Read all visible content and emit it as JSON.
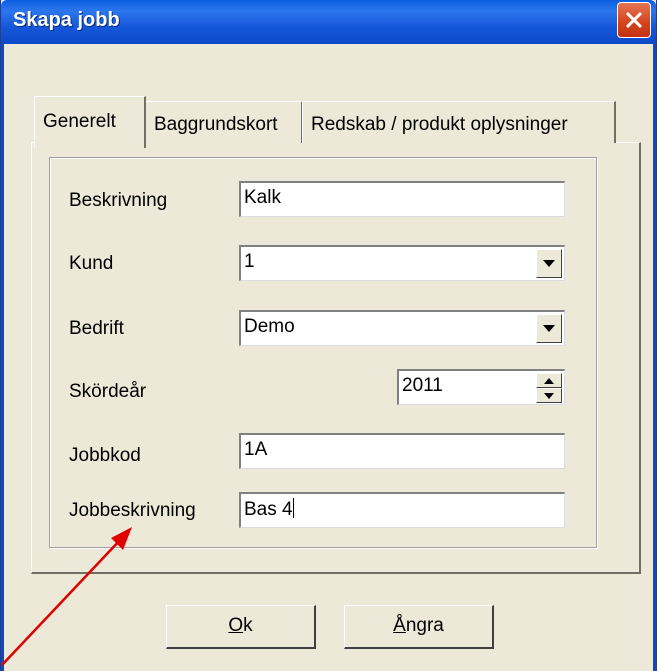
{
  "window": {
    "title": "Skapa jobb"
  },
  "tabs": [
    "Generelt",
    "Baggrundskort",
    "Redskab / produkt oplysninger"
  ],
  "fields": {
    "beskrivning": {
      "label": "Beskrivning",
      "value": "Kalk"
    },
    "kund": {
      "label": "Kund",
      "value": "1"
    },
    "bedrift": {
      "label": "Bedrift",
      "value": "Demo"
    },
    "skordear": {
      "label": "Skördeår",
      "value": "2011"
    },
    "jobbkod": {
      "label": "Jobbkod",
      "value": "1A"
    },
    "jobbeskrivning": {
      "label": "Jobbeskrivning",
      "value": "Bas 4"
    }
  },
  "buttons": {
    "ok": {
      "mnemonic": "O",
      "rest": "k"
    },
    "angra": {
      "mnemonic": "Å",
      "rest": "ngra"
    }
  },
  "colors": {
    "titlebar": "#0b49c8",
    "close": "#d3431c",
    "annotation_arrow": "#e00000",
    "face": "#ece9d8"
  }
}
